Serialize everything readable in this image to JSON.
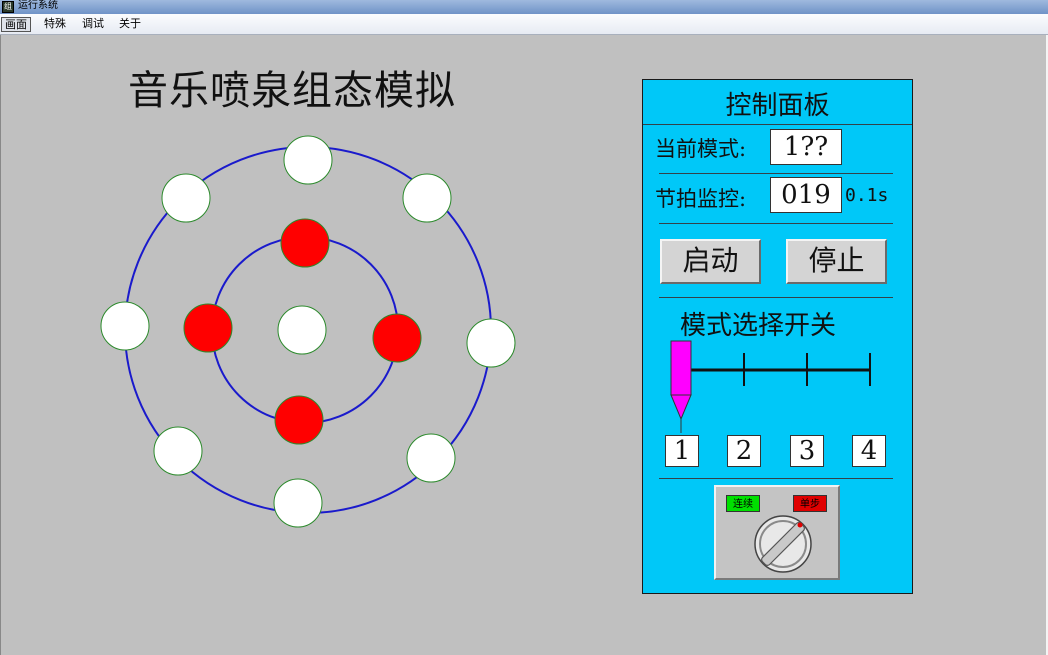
{
  "window": {
    "title": "运行系统"
  },
  "menu": [
    {
      "label": "画面",
      "active": true
    },
    {
      "label": "特殊",
      "active": false
    },
    {
      "label": "调试",
      "active": false
    },
    {
      "label": "关于",
      "active": false
    }
  ],
  "page": {
    "title": "音乐喷泉组态模拟"
  },
  "fountain": {
    "colors": {
      "ring_stroke": "#1a1acc",
      "outline": "#2c8a2c",
      "off": "#ffffff",
      "on": "#ff0000"
    },
    "outer_lights": [
      {
        "id": "outer-1",
        "state": "off"
      },
      {
        "id": "outer-2",
        "state": "off"
      },
      {
        "id": "outer-3",
        "state": "off"
      },
      {
        "id": "outer-4",
        "state": "off"
      },
      {
        "id": "outer-5",
        "state": "off"
      },
      {
        "id": "outer-6",
        "state": "off"
      },
      {
        "id": "outer-7",
        "state": "off"
      },
      {
        "id": "outer-8",
        "state": "off"
      }
    ],
    "inner_lights": [
      {
        "id": "inner-top",
        "state": "on"
      },
      {
        "id": "inner-right",
        "state": "on"
      },
      {
        "id": "inner-bottom",
        "state": "on"
      },
      {
        "id": "inner-left",
        "state": "on"
      }
    ],
    "center_light": {
      "state": "off"
    }
  },
  "panel": {
    "title": "控制面板",
    "mode_label": "当前模式:",
    "mode_value": "1??",
    "beat_label": "节拍监控:",
    "beat_value": "019",
    "beat_unit": "0.1s",
    "start_button": "启动",
    "stop_button": "停止",
    "switch_title": "模式选择开关",
    "switch_positions": [
      "1",
      "2",
      "3",
      "4"
    ],
    "switch_selected": 1,
    "knob": {
      "left_label": "连续",
      "right_label": "单步",
      "left_color": "#00e000",
      "right_color": "#e00000"
    },
    "colors": {
      "panel_bg": "#00c8f8",
      "pointer": "#ff00ff"
    }
  }
}
